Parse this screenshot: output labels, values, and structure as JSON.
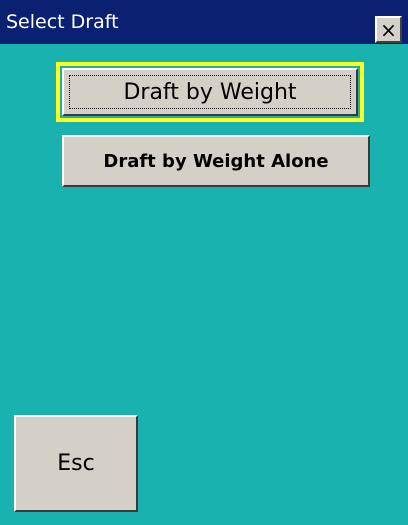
{
  "window": {
    "title": "Select Draft",
    "close_symbol": "×"
  },
  "buttons": {
    "draft_by_weight": "Draft by Weight",
    "draft_by_weight_alone": "Draft by Weight Alone",
    "esc": "Esc"
  },
  "colors": {
    "background": "#1ab2ae",
    "titlebar": "#0a2070",
    "focus_ring": "#ffff1e",
    "button_face": "#d4d0c8"
  },
  "icons": {
    "close": "close-icon"
  }
}
